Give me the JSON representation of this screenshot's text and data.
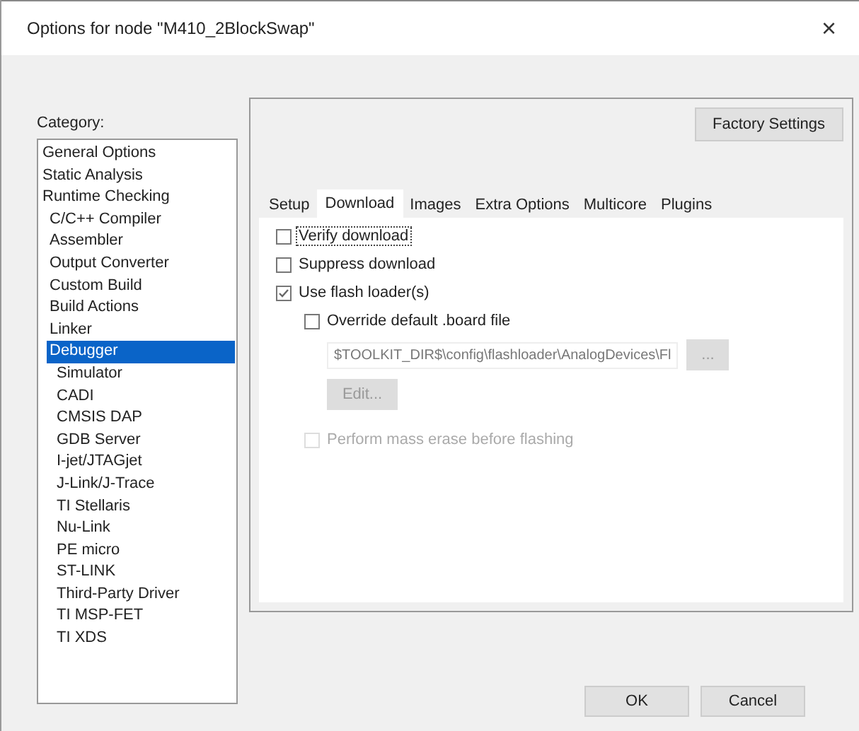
{
  "window": {
    "title": "Options for node \"M410_2BlockSwap\"",
    "close": "×"
  },
  "category": {
    "label": "Category:",
    "items": [
      {
        "label": "General Options",
        "selected": false
      },
      {
        "label": "Static Analysis",
        "selected": false
      },
      {
        "label": "Runtime Checking",
        "selected": false,
        "children": [
          {
            "label": "C/C++ Compiler",
            "selected": false
          },
          {
            "label": "Assembler",
            "selected": false
          },
          {
            "label": "Output Converter",
            "selected": false
          },
          {
            "label": "Custom Build",
            "selected": false
          },
          {
            "label": "Build Actions",
            "selected": false
          },
          {
            "label": "Linker",
            "selected": false
          },
          {
            "label": "Debugger",
            "selected": true,
            "children": [
              {
                "label": "Simulator",
                "selected": false
              },
              {
                "label": "CADI",
                "selected": false
              },
              {
                "label": "CMSIS DAP",
                "selected": false
              },
              {
                "label": "GDB Server",
                "selected": false
              },
              {
                "label": "I-jet/JTAGjet",
                "selected": false
              },
              {
                "label": "J-Link/J-Trace",
                "selected": false
              },
              {
                "label": "TI Stellaris",
                "selected": false
              },
              {
                "label": "Nu-Link",
                "selected": false
              },
              {
                "label": "PE micro",
                "selected": false
              },
              {
                "label": "ST-LINK",
                "selected": false
              },
              {
                "label": "Third-Party Driver",
                "selected": false
              },
              {
                "label": "TI MSP-FET",
                "selected": false
              },
              {
                "label": "TI XDS",
                "selected": false
              }
            ]
          }
        ]
      }
    ]
  },
  "factory_button": "Factory Settings",
  "tabs": [
    {
      "label": "Setup",
      "selected": false
    },
    {
      "label": "Download",
      "selected": true
    },
    {
      "label": "Images",
      "selected": false
    },
    {
      "label": "Extra Options",
      "selected": false
    },
    {
      "label": "Multicore",
      "selected": false
    },
    {
      "label": "Plugins",
      "selected": false
    }
  ],
  "options": [
    {
      "kind": "checkbox",
      "label": "Verify download",
      "checked": false,
      "disabled": false,
      "focused": true
    },
    {
      "kind": "checkbox",
      "label": "Suppress download",
      "checked": false,
      "disabled": false,
      "focused": false
    },
    {
      "kind": "checkbox",
      "label": "Use flash loader(s)",
      "checked": true,
      "disabled": false,
      "focused": false,
      "children": [
        {
          "kind": "checkbox",
          "label": "Override default .board file",
          "checked": false,
          "disabled": false,
          "focused": false
        },
        {
          "kind": "path",
          "value": "$TOOLKIT_DIR$\\config\\flashloader\\AnalogDevices\\Fl",
          "button": "...",
          "disabled": true
        },
        {
          "kind": "button",
          "label": "Edit...",
          "disabled": true
        },
        {
          "kind": "checkbox",
          "label": "Perform mass erase before flashing",
          "checked": false,
          "disabled": true,
          "focused": false
        }
      ]
    }
  ],
  "buttons": [
    "OK",
    "Cancel"
  ]
}
